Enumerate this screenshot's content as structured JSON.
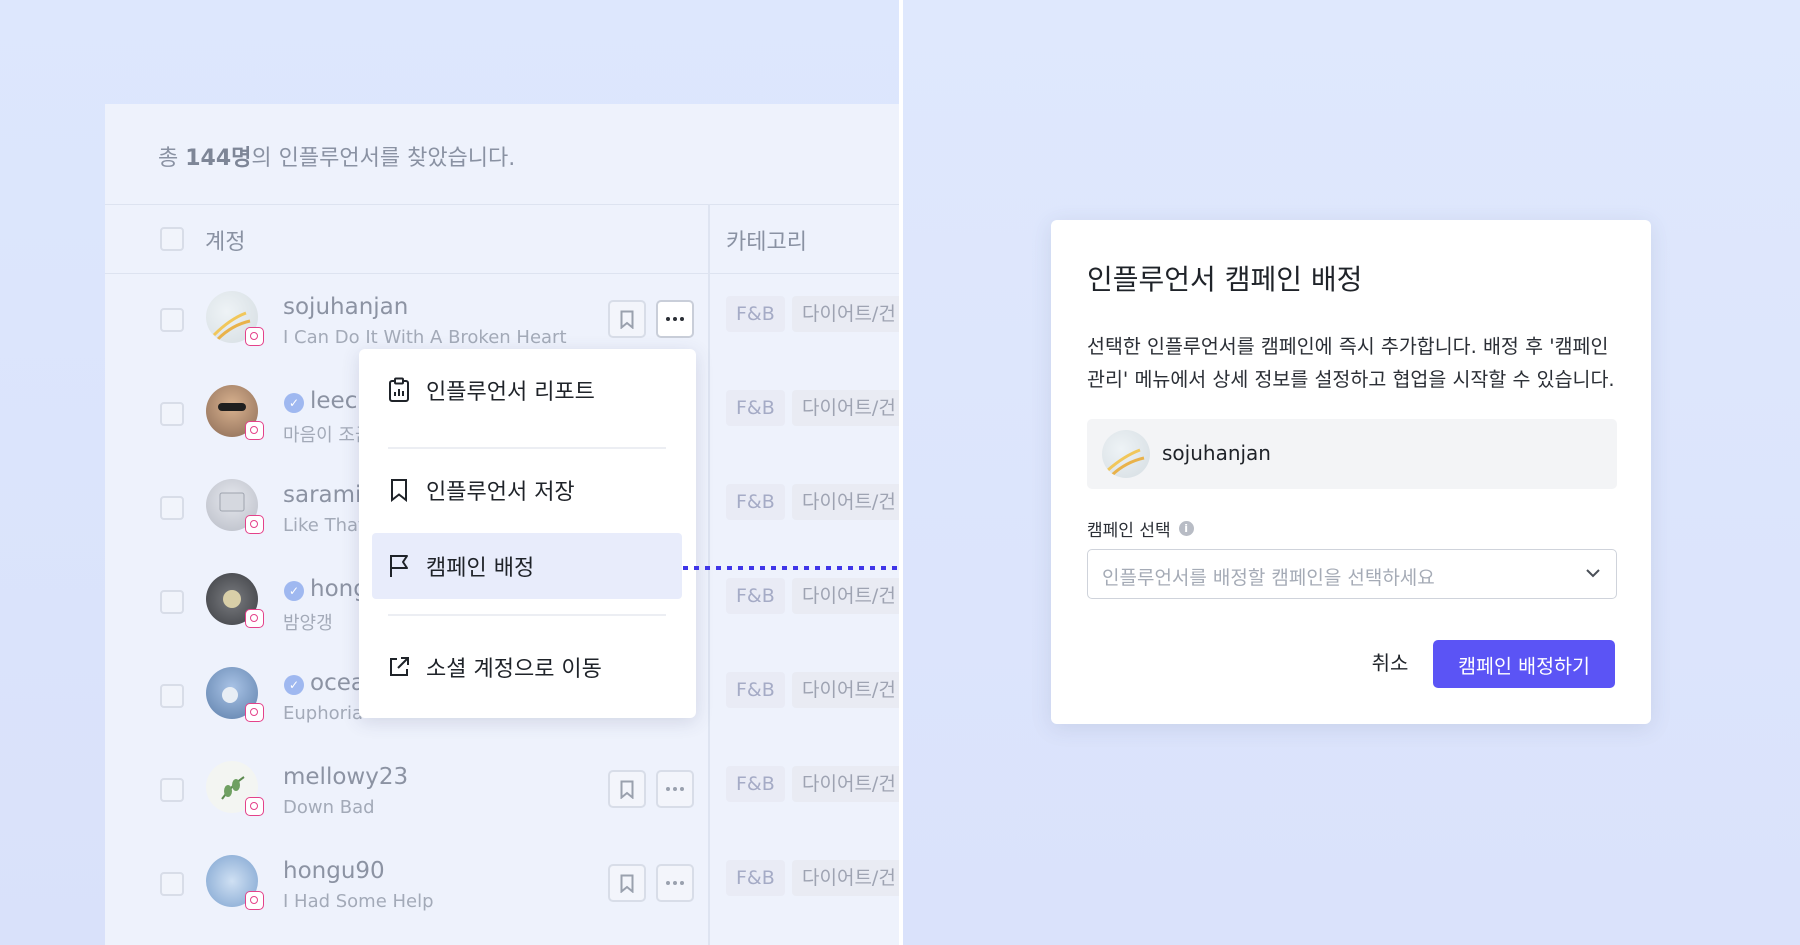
{
  "list": {
    "summary_prefix": "총 ",
    "summary_count": "144명",
    "summary_suffix": "의 인플루언서를 찾았습니다.",
    "header_account": "계정",
    "header_category": "카테고리",
    "rows": [
      {
        "username": "sojuhanjan",
        "subtitle": "I Can Do It With A Broken Heart",
        "verified": false,
        "tag1": "F&B",
        "tag2": "다이어트/건"
      },
      {
        "username": "leech",
        "subtitle": "마음이 조금",
        "verified": true,
        "tag1": "F&B",
        "tag2": "다이어트/건"
      },
      {
        "username": "saramin",
        "subtitle": "Like That",
        "verified": false,
        "tag1": "F&B",
        "tag2": "다이어트/건"
      },
      {
        "username": "hong",
        "subtitle": "밤양갱",
        "verified": true,
        "tag1": "F&B",
        "tag2": "다이어트/건"
      },
      {
        "username": "ocea",
        "subtitle": "Euphoria",
        "verified": true,
        "tag1": "F&B",
        "tag2": "다이어트/건"
      },
      {
        "username": "mellowy23",
        "subtitle": "Down Bad",
        "verified": false,
        "tag1": "F&B",
        "tag2": "다이어트/건"
      },
      {
        "username": "hongu90",
        "subtitle": "I Had Some Help",
        "verified": false,
        "tag1": "F&B",
        "tag2": "다이어트/건"
      }
    ]
  },
  "menu": {
    "items": [
      {
        "label": "인플루언서 리포트",
        "icon": "clipboard-icon"
      },
      {
        "label": "인플루언서 저장",
        "icon": "bookmark-icon"
      },
      {
        "label": "캠페인 배정",
        "icon": "flag-icon",
        "active": true
      },
      {
        "label": "소셜 계정으로 이동",
        "icon": "external-link-icon"
      }
    ]
  },
  "modal": {
    "title": "인플루언서 캠페인 배정",
    "description": "선택한 인플루언서를 캠페인에 즉시 추가합니다. 배정 후 '캠페인 관리' 메뉴에서 상세 정보를 설정하고 협업을 시작할 수 있습니다.",
    "selected_username": "sojuhanjan",
    "field_label": "캠페인 선택",
    "select_placeholder": "인플루언서를 배정할 캠페인을 선택하세요",
    "cancel_label": "취소",
    "confirm_label": "캠페인 배정하기"
  },
  "colors": {
    "accent": "#5b54f5",
    "arrow": "#3f35e8",
    "background": "#dfe7fb"
  }
}
